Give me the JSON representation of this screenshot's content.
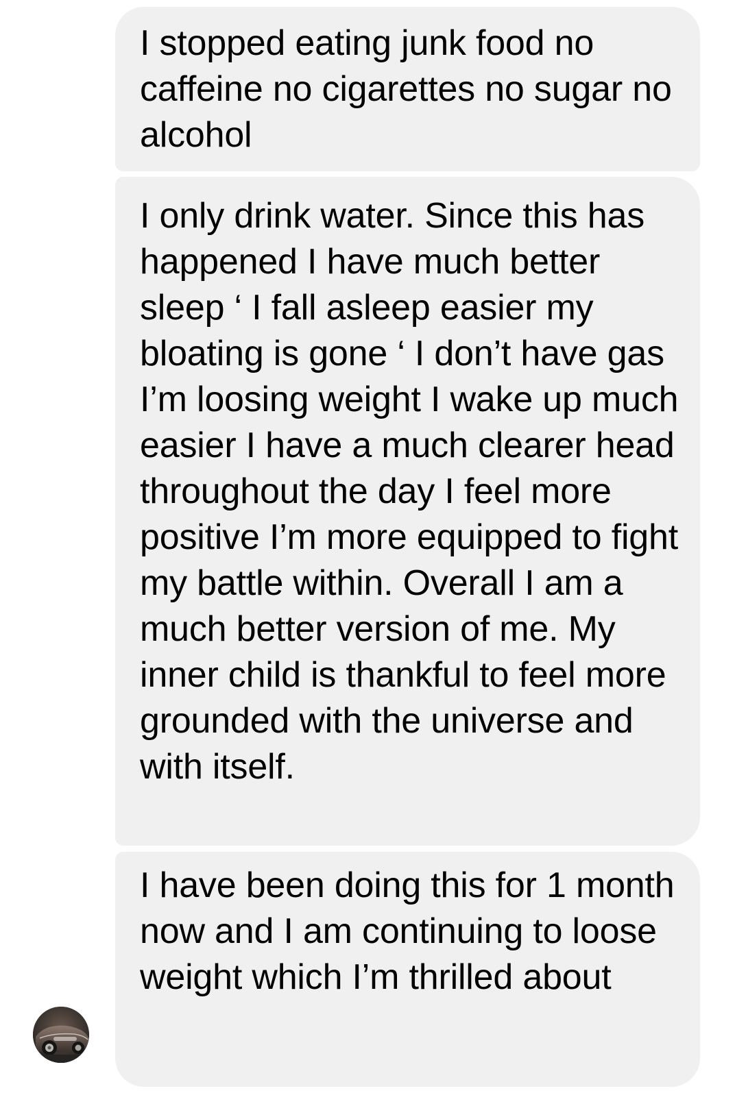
{
  "conversation": {
    "messages": [
      {
        "text": "I stopped eating junk food no caffeine no cigarettes no sugar no alcohol"
      },
      {
        "text": "I only drink water. Since this has happened I have much better sleep ‘ I fall asleep easier my bloating is gone ‘ I don’t have gas I’m loosing weight I wake up much easier I have a much clearer head throughout the day I feel more positive I’m more equipped to fight my battle within. Overall I am a much better version of me. My inner child is thankful to feel more grounded with the universe and with itself."
      },
      {
        "text": "I have been doing this for 1 month now and I am continuing to loose weight which I’m thrilled about"
      }
    ],
    "sender_avatar": {
      "icon": "vintage-car-avatar"
    }
  },
  "colors": {
    "bubble_background": "#f0f0f0",
    "text": "#000000",
    "page_background": "#ffffff"
  }
}
